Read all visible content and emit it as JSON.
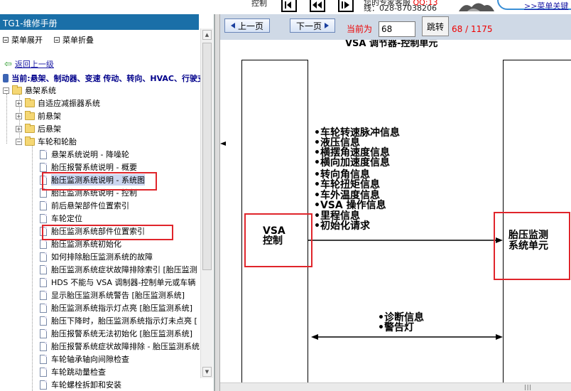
{
  "window": {
    "control_label": "控制",
    "support_text": "您的专家客服",
    "support_qq": "QQ:13",
    "support_phone": "线：028-87038206",
    "search_link": ">>菜单关键"
  },
  "left_panel": {
    "title": "TG1-维修手册",
    "expand_menu": "菜单展开",
    "collapse_menu": "菜单折叠",
    "back_link": "返回上一级",
    "current_path": "当前:悬架、制动器、变速 传动、转向、HVAC、行驶支持",
    "tree": [
      {
        "label": "悬架系统",
        "type": "folder",
        "expanded": true
      },
      {
        "label": "自适应减振器系统",
        "type": "folder",
        "expanded": false
      },
      {
        "label": "前悬架",
        "type": "folder",
        "expanded": false
      },
      {
        "label": "后悬架",
        "type": "folder",
        "expanded": false
      },
      {
        "label": "车轮和轮胎",
        "type": "folder",
        "expanded": true
      },
      {
        "label": "悬架系统说明 - 降噪轮",
        "type": "doc"
      },
      {
        "label": "胎压报警系统说明 - 概要",
        "type": "doc"
      },
      {
        "label": "胎压监测系统说明 - 系统图",
        "type": "doc",
        "selected": true
      },
      {
        "label": "胎压监测系统说明 - 控制",
        "type": "doc"
      },
      {
        "label": "前后悬架部件位置索引",
        "type": "doc"
      },
      {
        "label": "车轮定位",
        "type": "doc"
      },
      {
        "label": "胎压监测系统部件位置索引",
        "type": "doc"
      },
      {
        "label": "胎压监测系统初始化",
        "type": "doc"
      },
      {
        "label": "如何排除胎压监测系统的故障",
        "type": "doc"
      },
      {
        "label": "胎压监测系统症状故障排除索引 [胎压监测",
        "type": "doc"
      },
      {
        "label": "HDS 不能与 VSA 调制器-控制单元或车辆",
        "type": "doc"
      },
      {
        "label": "显示胎压监测系统警告 [胎压监测系统]",
        "type": "doc"
      },
      {
        "label": "胎压监测系统指示灯点亮 [胎压监测系统]",
        "type": "doc"
      },
      {
        "label": "胎压下降时，胎压监测系统指示灯未点亮 [",
        "type": "doc"
      },
      {
        "label": "胎压报警系统无法初始化 [胎压监测系统]",
        "type": "doc"
      },
      {
        "label": "胎压报警系统症状故障排除 - 胎压监测系统",
        "type": "doc"
      },
      {
        "label": "车轮轴承轴向间隙检查",
        "type": "doc"
      },
      {
        "label": "车轮跳动量检查",
        "type": "doc"
      },
      {
        "label": "车轮螺栓拆卸和安装",
        "type": "doc"
      }
    ]
  },
  "navigation": {
    "prev_label": "上一页",
    "next_label": "下一页",
    "current_label": "当前为",
    "page_value": "68",
    "go_label": "跳转",
    "page_count": "68 / 1175"
  },
  "diagram": {
    "title": "VSA 调节器-控制单元",
    "left_box": {
      "line1": "VSA",
      "line2": "控制"
    },
    "right_box": {
      "line1": "胎压监测",
      "line2": "系统单元"
    },
    "signals_to_right": [
      "•车轮转速脉冲信息",
      "•液压信息",
      "•横摆角速度信息",
      "•横向加速度信息",
      "•转向角信息",
      "•车轮扭矩信息",
      "•车外温度信息",
      "•VSA 操作信息",
      "•里程信息",
      "•初始化请求"
    ],
    "signals_bidirectional": [
      "•诊断信息",
      "•警告灯"
    ]
  }
}
